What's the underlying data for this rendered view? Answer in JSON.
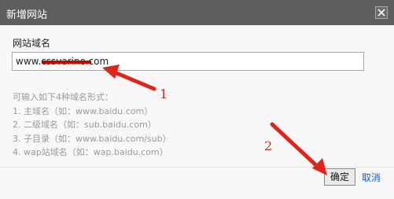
{
  "dialog": {
    "title": "新增网站",
    "close_icon": "close-icon",
    "field_label": "网站域名",
    "input_value": "www.cssvarino.com",
    "hint_title": "可输入如下4种域名形式：",
    "hints": [
      "1. 主域名（如：www.baidu.com）",
      "2. 二级域名（如：sub.baidu.com）",
      "3. 子目录（如：www.baidu.com/sub）",
      "4. wap站域名（如：wap.baidu.com）"
    ],
    "ok_label": "确定",
    "cancel_label": "取消"
  },
  "annotations": {
    "step1": "1",
    "step2": "2"
  },
  "colors": {
    "titlebar": "#5e5e5e",
    "annotation": "#c0302a",
    "link": "#1a5fb4"
  }
}
